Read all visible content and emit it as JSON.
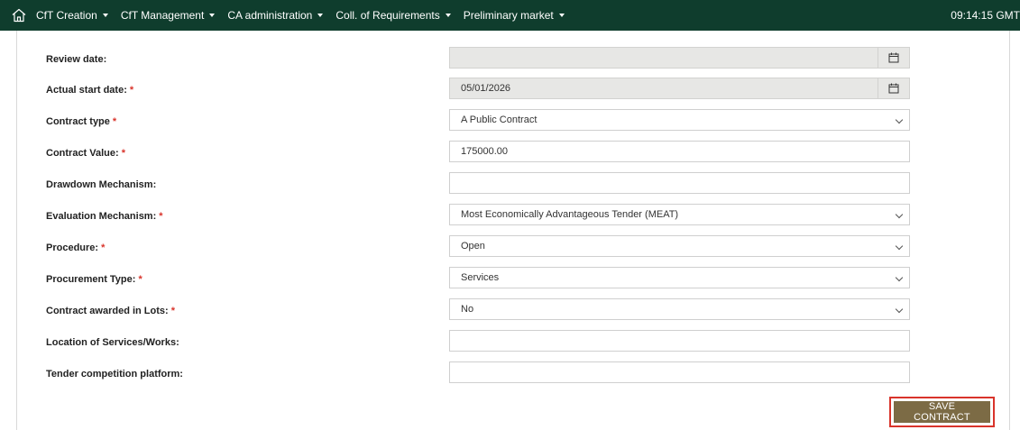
{
  "topbar": {
    "nav": [
      {
        "label": "CfT Creation"
      },
      {
        "label": "CfT Management"
      },
      {
        "label": "CA administration"
      },
      {
        "label": "Coll. of Requirements"
      },
      {
        "label": "Preliminary market"
      }
    ],
    "clock": "09:14:15 GMT"
  },
  "form": {
    "review_date": {
      "label": "Review date:",
      "value": ""
    },
    "actual_start_date": {
      "label": "Actual start date:",
      "required_mark": "*",
      "value": "05/01/2026"
    },
    "contract_type": {
      "label": "Contract type",
      "required_mark": "*",
      "value": "A Public Contract"
    },
    "contract_value": {
      "label": "Contract Value:",
      "required_mark": "*",
      "value": "175000.00"
    },
    "drawdown_mechanism": {
      "label": "Drawdown Mechanism:",
      "value": ""
    },
    "evaluation_mechanism": {
      "label": "Evaluation Mechanism:",
      "required_mark": "*",
      "value": "Most Economically Advantageous Tender (MEAT)"
    },
    "procedure": {
      "label": "Procedure:",
      "required_mark": "*",
      "value": "Open"
    },
    "procurement_type": {
      "label": "Procurement Type:",
      "required_mark": "*",
      "value": "Services"
    },
    "awarded_in_lots": {
      "label": "Contract awarded in Lots:",
      "required_mark": "*",
      "value": "No"
    },
    "location": {
      "label": "Location of Services/Works:",
      "value": ""
    },
    "tender_platform": {
      "label": "Tender competition platform:",
      "value": ""
    }
  },
  "actions": {
    "save_label": "SAVE CONTRACT"
  },
  "colors": {
    "topbar_bg": "#0f3d2d",
    "save_bg": "#7c6b45",
    "highlight_border": "#d9342b",
    "required": "#d9342b"
  }
}
